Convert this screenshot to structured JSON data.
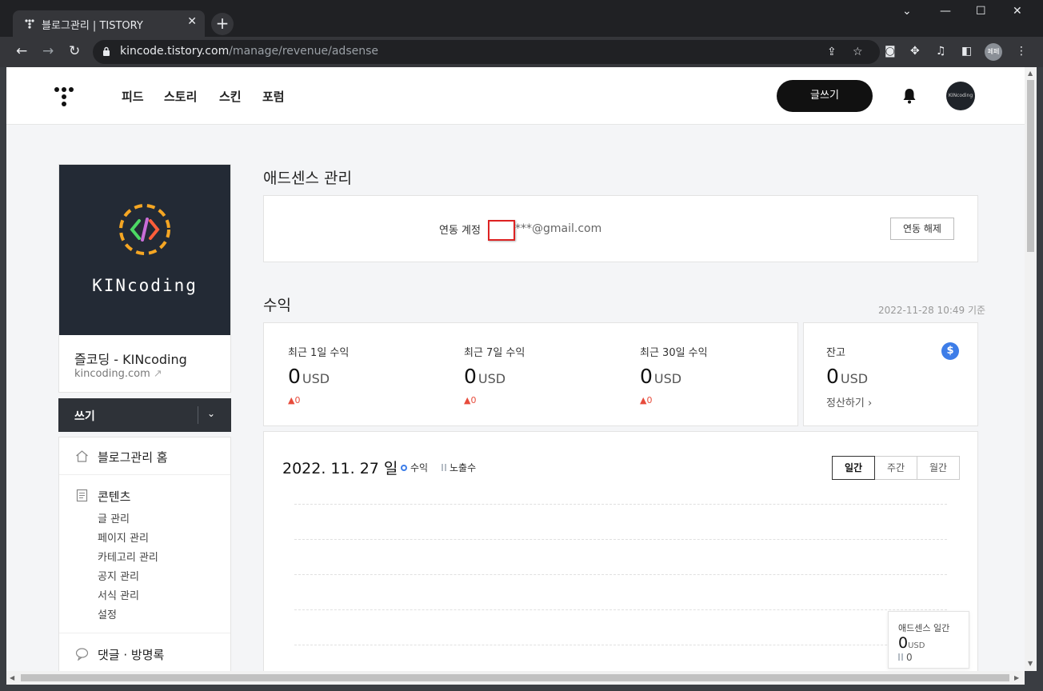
{
  "browser": {
    "tab_title": "블로그관리 | TISTORY",
    "tab_close": "✕",
    "new_tab": "+",
    "window_controls": [
      "⌄",
      "—",
      "☐",
      "✕"
    ],
    "url_host": "kincode.tistory.com",
    "url_path": "/manage/revenue/adsense",
    "profile_label": "페페",
    "icons": [
      "back-arrow-icon",
      "forward-arrow-icon",
      "reload-icon",
      "lock-icon",
      "share-icon",
      "star-icon",
      "camera-icon",
      "extensions-icon",
      "media-icon",
      "side-panel-icon",
      "kebab-menu-icon"
    ]
  },
  "header": {
    "nav": [
      "피드",
      "스토리",
      "스킨",
      "포럼"
    ],
    "write_label": "글쓰기",
    "avatar_text": "KINcoding"
  },
  "sidebar": {
    "blog_image_text": "KINcoding",
    "blog_name": "즐코딩 - KINcoding",
    "blog_url": "kincoding.com",
    "compose_label": "쓰기",
    "menu": {
      "home": "블로그관리 홈",
      "contents": "콘텐츠",
      "contents_items": [
        "글 관리",
        "페이지 관리",
        "카테고리 관리",
        "공지 관리",
        "서식 관리",
        "설정"
      ],
      "comments": "댓글 · 방명록"
    }
  },
  "adsense": {
    "title": "애드센스 관리",
    "link_label": "연동 계정",
    "email": "***@gmail.com",
    "unlink_button": "연동 해제"
  },
  "revenue": {
    "title": "수익",
    "updated": "2022-11-28 10:49 기준",
    "cards": [
      {
        "label": "최근 1일 수익",
        "value": "0",
        "unit": "USD",
        "delta": "▲0"
      },
      {
        "label": "최근 7일 수익",
        "value": "0",
        "unit": "USD",
        "delta": "▲0"
      },
      {
        "label": "최근 30일 수익",
        "value": "0",
        "unit": "USD",
        "delta": "▲0"
      }
    ],
    "balance": {
      "label": "잔고",
      "value": "0",
      "unit": "USD",
      "settle": "정산하기 ›",
      "icon": "$"
    }
  },
  "chart": {
    "date": "2022. 11. 27 일",
    "legend_revenue": "수익",
    "legend_impressions": "노출수",
    "periods": [
      "일간",
      "주간",
      "월간"
    ],
    "active_period": "일간",
    "tooltip": {
      "title": "애드센스 일간",
      "value": "0",
      "unit": "USD",
      "impressions": "0"
    }
  },
  "chart_data": {
    "type": "line",
    "title": "",
    "x": [
      "2022. 11. 27"
    ],
    "series": [
      {
        "name": "수익",
        "values": [
          0
        ]
      },
      {
        "name": "노출수",
        "values": [
          0
        ]
      }
    ]
  }
}
